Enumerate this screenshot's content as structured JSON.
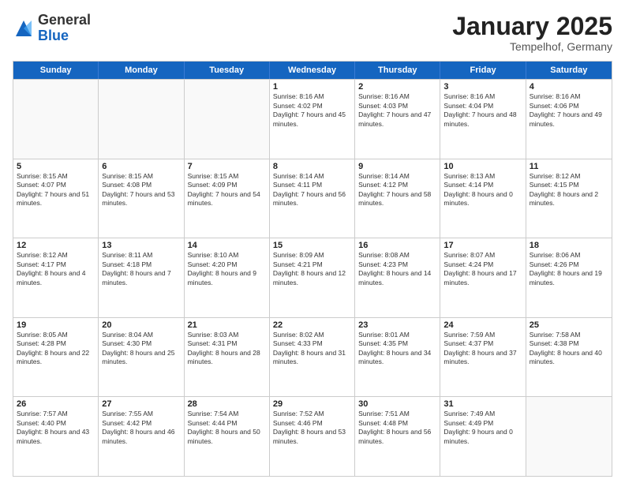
{
  "logo": {
    "general": "General",
    "blue": "Blue"
  },
  "header": {
    "month_year": "January 2025",
    "location": "Tempelhof, Germany"
  },
  "days_of_week": [
    "Sunday",
    "Monday",
    "Tuesday",
    "Wednesday",
    "Thursday",
    "Friday",
    "Saturday"
  ],
  "weeks": [
    [
      {
        "day": "",
        "empty": true
      },
      {
        "day": "",
        "empty": true
      },
      {
        "day": "",
        "empty": true
      },
      {
        "day": "1",
        "sunrise": "8:16 AM",
        "sunset": "4:02 PM",
        "daylight": "7 hours and 45 minutes."
      },
      {
        "day": "2",
        "sunrise": "8:16 AM",
        "sunset": "4:03 PM",
        "daylight": "7 hours and 47 minutes."
      },
      {
        "day": "3",
        "sunrise": "8:16 AM",
        "sunset": "4:04 PM",
        "daylight": "7 hours and 48 minutes."
      },
      {
        "day": "4",
        "sunrise": "8:16 AM",
        "sunset": "4:06 PM",
        "daylight": "7 hours and 49 minutes."
      }
    ],
    [
      {
        "day": "5",
        "sunrise": "8:15 AM",
        "sunset": "4:07 PM",
        "daylight": "7 hours and 51 minutes."
      },
      {
        "day": "6",
        "sunrise": "8:15 AM",
        "sunset": "4:08 PM",
        "daylight": "7 hours and 53 minutes."
      },
      {
        "day": "7",
        "sunrise": "8:15 AM",
        "sunset": "4:09 PM",
        "daylight": "7 hours and 54 minutes."
      },
      {
        "day": "8",
        "sunrise": "8:14 AM",
        "sunset": "4:11 PM",
        "daylight": "7 hours and 56 minutes."
      },
      {
        "day": "9",
        "sunrise": "8:14 AM",
        "sunset": "4:12 PM",
        "daylight": "7 hours and 58 minutes."
      },
      {
        "day": "10",
        "sunrise": "8:13 AM",
        "sunset": "4:14 PM",
        "daylight": "8 hours and 0 minutes."
      },
      {
        "day": "11",
        "sunrise": "8:12 AM",
        "sunset": "4:15 PM",
        "daylight": "8 hours and 2 minutes."
      }
    ],
    [
      {
        "day": "12",
        "sunrise": "8:12 AM",
        "sunset": "4:17 PM",
        "daylight": "8 hours and 4 minutes."
      },
      {
        "day": "13",
        "sunrise": "8:11 AM",
        "sunset": "4:18 PM",
        "daylight": "8 hours and 7 minutes."
      },
      {
        "day": "14",
        "sunrise": "8:10 AM",
        "sunset": "4:20 PM",
        "daylight": "8 hours and 9 minutes."
      },
      {
        "day": "15",
        "sunrise": "8:09 AM",
        "sunset": "4:21 PM",
        "daylight": "8 hours and 12 minutes."
      },
      {
        "day": "16",
        "sunrise": "8:08 AM",
        "sunset": "4:23 PM",
        "daylight": "8 hours and 14 minutes."
      },
      {
        "day": "17",
        "sunrise": "8:07 AM",
        "sunset": "4:24 PM",
        "daylight": "8 hours and 17 minutes."
      },
      {
        "day": "18",
        "sunrise": "8:06 AM",
        "sunset": "4:26 PM",
        "daylight": "8 hours and 19 minutes."
      }
    ],
    [
      {
        "day": "19",
        "sunrise": "8:05 AM",
        "sunset": "4:28 PM",
        "daylight": "8 hours and 22 minutes."
      },
      {
        "day": "20",
        "sunrise": "8:04 AM",
        "sunset": "4:30 PM",
        "daylight": "8 hours and 25 minutes."
      },
      {
        "day": "21",
        "sunrise": "8:03 AM",
        "sunset": "4:31 PM",
        "daylight": "8 hours and 28 minutes."
      },
      {
        "day": "22",
        "sunrise": "8:02 AM",
        "sunset": "4:33 PM",
        "daylight": "8 hours and 31 minutes."
      },
      {
        "day": "23",
        "sunrise": "8:01 AM",
        "sunset": "4:35 PM",
        "daylight": "8 hours and 34 minutes."
      },
      {
        "day": "24",
        "sunrise": "7:59 AM",
        "sunset": "4:37 PM",
        "daylight": "8 hours and 37 minutes."
      },
      {
        "day": "25",
        "sunrise": "7:58 AM",
        "sunset": "4:38 PM",
        "daylight": "8 hours and 40 minutes."
      }
    ],
    [
      {
        "day": "26",
        "sunrise": "7:57 AM",
        "sunset": "4:40 PM",
        "daylight": "8 hours and 43 minutes."
      },
      {
        "day": "27",
        "sunrise": "7:55 AM",
        "sunset": "4:42 PM",
        "daylight": "8 hours and 46 minutes."
      },
      {
        "day": "28",
        "sunrise": "7:54 AM",
        "sunset": "4:44 PM",
        "daylight": "8 hours and 50 minutes."
      },
      {
        "day": "29",
        "sunrise": "7:52 AM",
        "sunset": "4:46 PM",
        "daylight": "8 hours and 53 minutes."
      },
      {
        "day": "30",
        "sunrise": "7:51 AM",
        "sunset": "4:48 PM",
        "daylight": "8 hours and 56 minutes."
      },
      {
        "day": "31",
        "sunrise": "7:49 AM",
        "sunset": "4:49 PM",
        "daylight": "9 hours and 0 minutes."
      },
      {
        "day": "",
        "empty": true
      }
    ]
  ]
}
